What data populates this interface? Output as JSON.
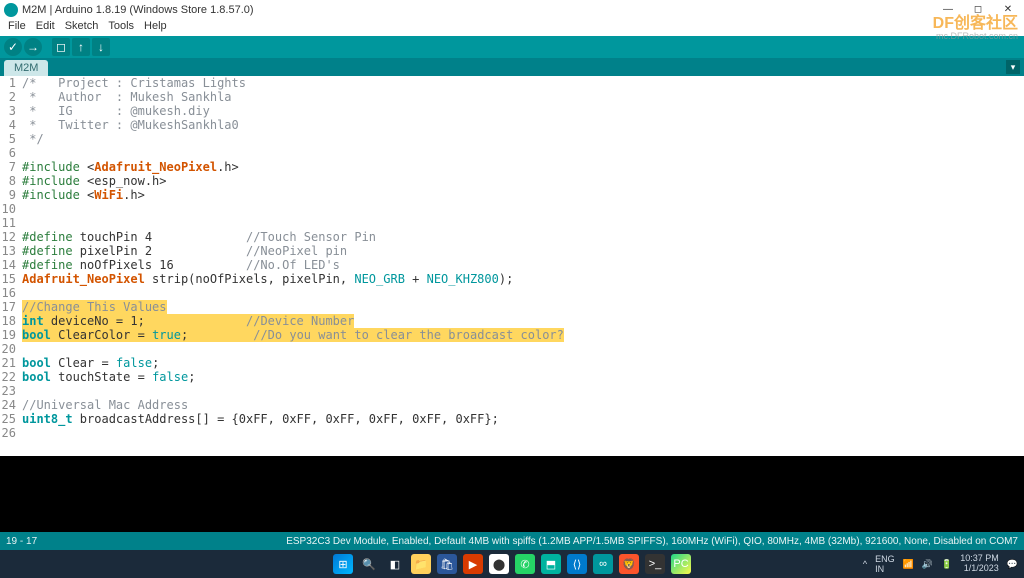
{
  "title": "M2M | Arduino 1.8.19 (Windows Store 1.8.57.0)",
  "menus": {
    "file": "File",
    "edit": "Edit",
    "sketch": "Sketch",
    "tools": "Tools",
    "help": "Help"
  },
  "toolbar": {
    "verify": "✓",
    "upload": "→",
    "new": "◻",
    "open": "↑",
    "save": "↓"
  },
  "tab": "M2M",
  "watermark": {
    "main": "DF创客社区",
    "sub": "mc.DFRobot.com.cn"
  },
  "code": {
    "l1a": "/*",
    "l1b": "   Project : Cristamas Lights",
    "l2a": " *",
    "l2b": "   Author  : Mukesh Sankhla",
    "l3a": " *",
    "l3b": "   IG      : @mukesh.diy",
    "l4a": " *",
    "l4b": "   Twitter : @MukeshSankhla0",
    "l5": " */",
    "l7inc": "#include",
    "l7a": " <",
    "l7b": "Adafruit_NeoPixel",
    "l7c": ".h>",
    "l8inc": "#include",
    "l8a": " <esp_now.h>",
    "l9inc": "#include",
    "l9a": " <",
    "l9b": "WiFi",
    "l9c": ".h>",
    "l12d": "#define",
    "l12a": " touchPin 4",
    "l12b": "             //Touch Sensor Pin",
    "l13d": "#define",
    "l13a": " pixelPin 2",
    "l13b": "             //NeoPixel pin",
    "l14d": "#define",
    "l14a": " noOfPixels 16",
    "l14b": "          //No.Of LED's",
    "l15a": "Adafruit_NeoPixel",
    "l15b": " strip(noOfPixels, pixelPin, ",
    "l15c": "NEO_GRB",
    "l15d": " + ",
    "l15e": "NEO_KHZ800",
    "l15f": ");",
    "l17": "//Change This Values",
    "l18a": "int",
    "l18b": " deviceNo = 1;",
    "l18c": "              //Device Number",
    "l19a": "bool",
    "l19b": " ClearColor = ",
    "l19c": "true",
    "l19d": ";",
    "l19e": "         //Do you want to clear the broadcast color?",
    "l21a": "bool",
    "l21b": " Clear = ",
    "l21c": "false",
    "l21d": ";",
    "l22a": "bool",
    "l22b": " touchState = ",
    "l22c": "false",
    "l22d": ";",
    "l24": "//Universal Mac Address",
    "l25a": "uint8_t",
    "l25b": " broadcastAddress[] = {0xFF, 0xFF, 0xFF, 0xFF, 0xFF, 0xFF};"
  },
  "status": {
    "left": "19 - 17",
    "right": "ESP32C3 Dev Module, Enabled, Default 4MB with spiffs (1.2MB APP/1.5MB SPIFFS), 160MHz (WiFi), QIO, 80MHz, 4MB (32Mb), 921600, None, Disabled on COM7"
  },
  "tray": {
    "lang1": "ENG",
    "lang2": "IN",
    "time": "10:37 PM",
    "date": "1/1/2023"
  }
}
